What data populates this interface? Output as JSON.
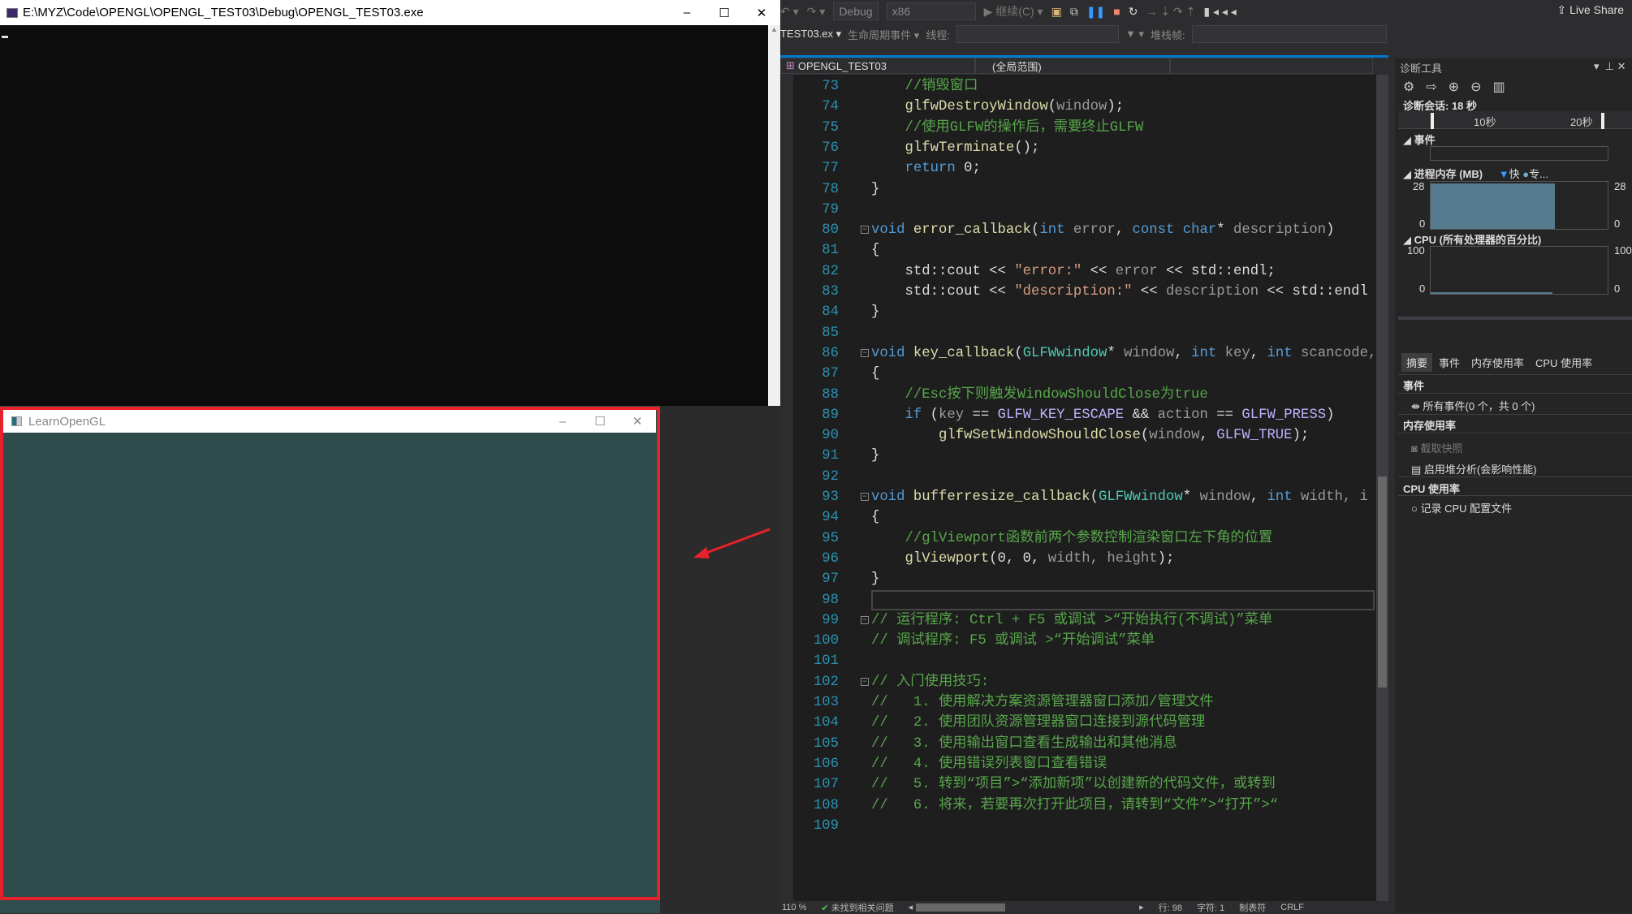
{
  "console": {
    "title": "E:\\MYZ\\Code\\OPENGL\\OPENGL_TEST03\\Debug\\OPENGL_TEST03.exe",
    "minimize": "–",
    "maximize": "☐",
    "close": "✕"
  },
  "gl_window": {
    "title": "LearnOpenGL",
    "minimize": "–",
    "maximize": "☐",
    "close": "✕",
    "clear_color": "#2f4f4f"
  },
  "annotation": {
    "frame_color": "#e8222a",
    "arrow_color": "#e8222a"
  },
  "toolbar": {
    "config": "Debug",
    "platform": "x86",
    "continue": "▶ 继续(C) ▾",
    "live_share": "Live Share",
    "process": "TEST03.ex ▾",
    "lifecycle": "生命周期事件 ▾",
    "thread_label": "线程:",
    "stack_label": "堆栈帧:"
  },
  "navbar": {
    "project": "OPENGL_TEST03",
    "scope": "(全局范围)"
  },
  "editor": {
    "lines": [
      {
        "n": "73",
        "t": [
          [
            "cm",
            "    //销毁窗口"
          ]
        ]
      },
      {
        "n": "74",
        "t": [
          [
            "fn",
            "    glfwDestroyWindow"
          ],
          [
            "tx",
            "("
          ],
          [
            "pm",
            "window"
          ],
          [
            "tx",
            ");"
          ]
        ]
      },
      {
        "n": "75",
        "t": [
          [
            "cm",
            "    //使用GLFW的操作后，需要终止GLFW"
          ]
        ]
      },
      {
        "n": "76",
        "t": [
          [
            "fn",
            "    glfwTerminate"
          ],
          [
            "tx",
            "();"
          ]
        ]
      },
      {
        "n": "77",
        "t": [
          [
            "kw",
            "    return"
          ],
          [
            "tx",
            " 0;"
          ]
        ]
      },
      {
        "n": "78",
        "t": [
          [
            "tx",
            "}"
          ]
        ]
      },
      {
        "n": "79",
        "t": []
      },
      {
        "n": "80",
        "fold": true,
        "t": [
          [
            "kw",
            "void"
          ],
          [
            "fn",
            " error_callback"
          ],
          [
            "tx",
            "("
          ],
          [
            "kw",
            "int"
          ],
          [
            "pm",
            " error"
          ],
          [
            "tx",
            ", "
          ],
          [
            "kw",
            "const char"
          ],
          [
            "tx",
            "* "
          ],
          [
            "pm",
            "description"
          ],
          [
            "tx",
            ")"
          ]
        ]
      },
      {
        "n": "81",
        "t": [
          [
            "tx",
            "{"
          ]
        ]
      },
      {
        "n": "82",
        "t": [
          [
            "tx",
            "    std::cout << "
          ],
          [
            "st",
            "\"error:\""
          ],
          [
            "tx",
            " << "
          ],
          [
            "pm",
            "error"
          ],
          [
            "tx",
            " << std::endl;"
          ]
        ]
      },
      {
        "n": "83",
        "t": [
          [
            "tx",
            "    std::cout << "
          ],
          [
            "st",
            "\"description:\""
          ],
          [
            "tx",
            " << "
          ],
          [
            "pm",
            "description"
          ],
          [
            "tx",
            " << std::endl"
          ]
        ]
      },
      {
        "n": "84",
        "t": [
          [
            "tx",
            "}"
          ]
        ]
      },
      {
        "n": "85",
        "t": []
      },
      {
        "n": "86",
        "fold": true,
        "t": [
          [
            "kw",
            "void"
          ],
          [
            "fn",
            " key_callback"
          ],
          [
            "tx",
            "("
          ],
          [
            "ty",
            "GLFWwindow"
          ],
          [
            "tx",
            "* "
          ],
          [
            "pm",
            "window"
          ],
          [
            "tx",
            ", "
          ],
          [
            "kw",
            "int"
          ],
          [
            "pm",
            " key"
          ],
          [
            "tx",
            ", "
          ],
          [
            "kw",
            "int"
          ],
          [
            "pm",
            " scancode,"
          ]
        ]
      },
      {
        "n": "87",
        "t": [
          [
            "tx",
            "{"
          ]
        ]
      },
      {
        "n": "88",
        "t": [
          [
            "cm",
            "    //Esc按下则触发WindowShouldClose为true"
          ]
        ]
      },
      {
        "n": "89",
        "t": [
          [
            "kw",
            "    if"
          ],
          [
            "tx",
            " ("
          ],
          [
            "pm",
            "key"
          ],
          [
            "tx",
            " == "
          ],
          [
            "mc",
            "GLFW_KEY_ESCAPE"
          ],
          [
            "tx",
            " && "
          ],
          [
            "pm",
            "action"
          ],
          [
            "tx",
            " == "
          ],
          [
            "mc",
            "GLFW_PRESS"
          ],
          [
            "tx",
            ")"
          ]
        ]
      },
      {
        "n": "90",
        "t": [
          [
            "fn",
            "        glfwSetWindowShouldClose"
          ],
          [
            "tx",
            "("
          ],
          [
            "pm",
            "window"
          ],
          [
            "tx",
            ", "
          ],
          [
            "mc",
            "GLFW_TRUE"
          ],
          [
            "tx",
            ");"
          ]
        ]
      },
      {
        "n": "91",
        "t": [
          [
            "tx",
            "}"
          ]
        ]
      },
      {
        "n": "92",
        "t": []
      },
      {
        "n": "93",
        "fold": true,
        "t": [
          [
            "kw",
            "void"
          ],
          [
            "fn",
            " bufferresize_callback"
          ],
          [
            "tx",
            "("
          ],
          [
            "ty",
            "GLFWwindow"
          ],
          [
            "tx",
            "* "
          ],
          [
            "pm",
            "window"
          ],
          [
            "tx",
            ", "
          ],
          [
            "kw",
            "int"
          ],
          [
            "pm",
            " width, i"
          ]
        ]
      },
      {
        "n": "94",
        "t": [
          [
            "tx",
            "{"
          ]
        ]
      },
      {
        "n": "95",
        "t": [
          [
            "cm",
            "    //glViewport函数前两个参数控制渲染窗口左下角的位置"
          ]
        ]
      },
      {
        "n": "96",
        "t": [
          [
            "fn",
            "    glViewport"
          ],
          [
            "tx",
            "(0, 0, "
          ],
          [
            "pm",
            "width, height"
          ],
          [
            "tx",
            ");"
          ]
        ]
      },
      {
        "n": "97",
        "t": [
          [
            "tx",
            "}"
          ]
        ]
      },
      {
        "n": "98",
        "current": true,
        "t": []
      },
      {
        "n": "99",
        "fold": true,
        "t": [
          [
            "cm",
            "// 运行程序: Ctrl + F5 或调试 >“开始执行(不调试)”菜单"
          ]
        ]
      },
      {
        "n": "100",
        "t": [
          [
            "cm",
            "// 调试程序: F5 或调试 >“开始调试”菜单"
          ]
        ]
      },
      {
        "n": "101",
        "t": []
      },
      {
        "n": "102",
        "fold": true,
        "t": [
          [
            "cm",
            "// 入门使用技巧:"
          ]
        ]
      },
      {
        "n": "103",
        "t": [
          [
            "cm",
            "//   1. 使用解决方案资源管理器窗口添加/管理文件"
          ]
        ]
      },
      {
        "n": "104",
        "t": [
          [
            "cm",
            "//   2. 使用团队资源管理器窗口连接到源代码管理"
          ]
        ]
      },
      {
        "n": "105",
        "t": [
          [
            "cm",
            "//   3. 使用输出窗口查看生成输出和其他消息"
          ]
        ]
      },
      {
        "n": "106",
        "t": [
          [
            "cm",
            "//   4. 使用错误列表窗口查看错误"
          ]
        ]
      },
      {
        "n": "107",
        "t": [
          [
            "cm",
            "//   5. 转到“项目”>“添加新项”以创建新的代码文件，或转到"
          ]
        ]
      },
      {
        "n": "108",
        "t": [
          [
            "cm",
            "//   6. 将来，若要再次打开此项目，请转到“文件”>“打开”>“"
          ]
        ]
      },
      {
        "n": "109",
        "t": []
      }
    ]
  },
  "status": {
    "zoom": "110 %",
    "issues": "未找到相关问题",
    "line": "行: 98",
    "char": "字符: 1",
    "tabs": "制表符",
    "eol": "CRLF"
  },
  "diag": {
    "title": "诊断工具",
    "session": "诊断会话: 18 秒",
    "ticks": [
      "10秒",
      "20秒"
    ],
    "events_header": "事件",
    "memory_header": "进程内存 (MB)",
    "legend_fast": "快",
    "legend_private": "专...",
    "memory_axis": {
      "max": "28",
      "min": "0"
    },
    "memory_value_mb": 27,
    "memory_fill_fraction": 0.7,
    "cpu_header": "CPU (所有处理器的百分比)",
    "cpu_axis": {
      "max": "100",
      "min": "0"
    },
    "tabs": [
      "摘要",
      "事件",
      "内存使用率",
      "CPU 使用率"
    ],
    "sec_events": "事件",
    "all_events": "所有事件(0 个，共 0 个)",
    "sec_memory": "内存使用率",
    "snapshot": "截取快照",
    "heap": "启用堆分析(会影响性能)",
    "sec_cpu": "CPU 使用率",
    "record_cpu": "记录 CPU 配置文件"
  }
}
